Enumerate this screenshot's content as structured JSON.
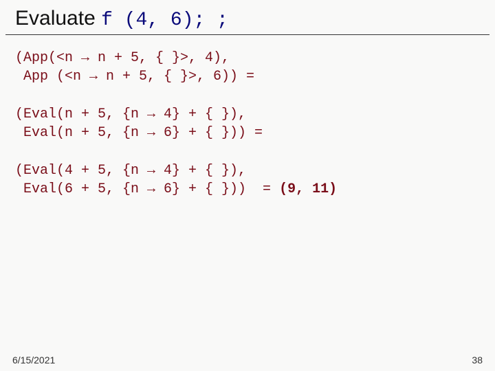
{
  "title": {
    "lead": "Evaluate ",
    "code": "f (4, 6); ;"
  },
  "blocks": {
    "b1_l1": "(App(<n → n + 5, { }>, 4),",
    "b1_l2": " App (<n → n + 5, { }>, 6)) =",
    "b2_l1": "(Eval(n + 5, {n → 4} + { }),",
    "b2_l2": " Eval(n + 5, {n → 6} + { })) =",
    "b3_l1": "(Eval(4 + 5, {n → 4} + { }),",
    "b3_l2": " Eval(6 + 5, {n → 6} + { }))  = ",
    "b3_result": "(9, 11)"
  },
  "footer": {
    "date": "6/15/2021",
    "page": "38"
  }
}
